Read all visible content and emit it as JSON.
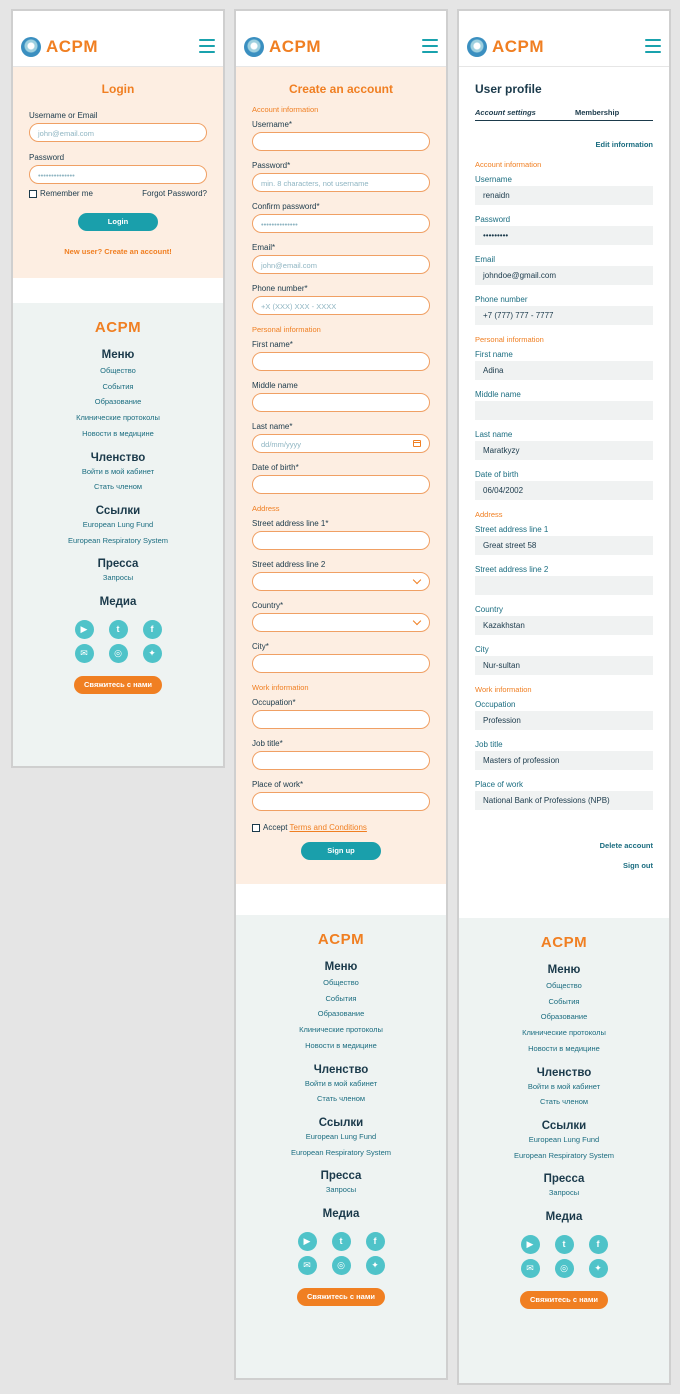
{
  "brand": "ACPM",
  "login": {
    "title": "Login",
    "username_label": "Username or Email",
    "username_placeholder": "john@email.com",
    "password_label": "Password",
    "password_placeholder": "••••••••••••••",
    "remember_label": "Remember me",
    "forgot_label": "Forgot Password?",
    "login_button": "Login",
    "new_user_link": "New user? Create an account!"
  },
  "signup": {
    "title": "Create an account",
    "account_section": "Account information",
    "username_label": "Username*",
    "password_label": "Password*",
    "password_placeholder": "min. 8 characters, not username",
    "confirm_label": "Confirm password*",
    "confirm_placeholder": "••••••••••••••",
    "email_label": "Email*",
    "email_placeholder": "john@email.com",
    "phone_label": "Phone number*",
    "phone_placeholder": "+X (XXX) XXX - XXXX",
    "personal_section": "Personal information",
    "first_label": "First name*",
    "middle_label": "Middle name",
    "last_label": "Last name*",
    "last_placeholder": "dd/mm/yyyy",
    "dob_label": "Date of birth*",
    "address_section": "Address",
    "street1_label": "Street address line 1*",
    "street2_label": "Street address line 2",
    "country_label": "Country*",
    "city_label": "City*",
    "work_section": "Work information",
    "occupation_label": "Occupation*",
    "jobtitle_label": "Job title*",
    "place_label": "Place of work*",
    "accept_label": "Accept",
    "terms_link": "Terms and Conditions",
    "signup_button": "Sign up"
  },
  "profile": {
    "title": "User profile",
    "tab_account": "Account settings",
    "tab_membership": "Membership",
    "edit_link": "Edit information",
    "account_section": "Account information",
    "username_label": "Username",
    "username_value": "renaidn",
    "password_label": "Password",
    "password_value": "•••••••••",
    "email_label": "Email",
    "email_value": "johndoe@gmail.com",
    "phone_label": "Phone number",
    "phone_value": "+7 (777) 777 - 7777",
    "personal_section": "Personal information",
    "first_label": "First name",
    "first_value": "Adina",
    "middle_label": "Middle name",
    "middle_value": "",
    "last_label": "Last name",
    "last_value": "Maratkyzy",
    "dob_label": "Date of birth",
    "dob_value": "06/04/2002",
    "address_section": "Address",
    "street1_label": "Street address line 1",
    "street1_value": "Great street 58",
    "street2_label": "Street address line 2",
    "street2_value": "",
    "country_label": "Country",
    "country_value": "Kazakhstan",
    "city_label": "City",
    "city_value": "Nur-sultan",
    "work_section": "Work information",
    "occupation_label": "Occupation",
    "occupation_value": "Profession",
    "jobtitle_label": "Job title",
    "jobtitle_value": "Masters of profession",
    "place_label": "Place of work",
    "place_value": "National Bank of Professions (NPB)",
    "delete_link": "Delete account",
    "signout_link": "Sign out"
  },
  "footer": {
    "logo": "ACPM",
    "menu_title": "Меню",
    "menu_items": [
      "Общество",
      "События",
      "Образование",
      "Клинические протоколы",
      "Новости в медицине"
    ],
    "membership_title": "Членство",
    "membership_items": [
      "Войти в мой кабинет",
      "Стать членом"
    ],
    "links_title": "Ссылки",
    "links_items": [
      "European Lung Fund",
      "European Respiratory System"
    ],
    "press_title": "Пресса",
    "press_items": [
      "Запросы"
    ],
    "media_title": "Медиа",
    "social_icons": [
      "youtube-icon",
      "tumblr-icon",
      "facebook-icon",
      "messenger-icon",
      "instagram-icon",
      "twitter-icon"
    ],
    "contact_button": "Свяжитесь с нами"
  },
  "colors": {
    "accent_orange": "#f07f22",
    "teal": "#1a9fab",
    "peach_bg": "#fdeee2",
    "footer_bg": "#eef3f2"
  }
}
